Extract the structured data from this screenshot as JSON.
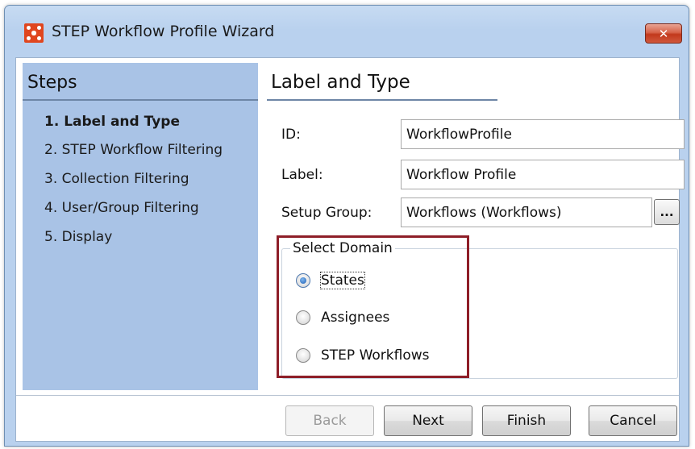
{
  "window": {
    "title": "STEP Workflow Profile Wizard",
    "close_glyph": "✕",
    "icon": "app-logo-icon"
  },
  "steps": {
    "title": "Steps",
    "items": [
      {
        "label": "1. Label and Type",
        "active": true
      },
      {
        "label": "2. STEP Workflow Filtering",
        "active": false
      },
      {
        "label": "3. Collection Filtering",
        "active": false
      },
      {
        "label": "4. User/Group Filtering",
        "active": false
      },
      {
        "label": "5. Display",
        "active": false
      }
    ]
  },
  "content": {
    "title": "Label and Type",
    "fields": {
      "id": {
        "label": "ID:",
        "value": "WorkflowProfile"
      },
      "label": {
        "label": "Label:",
        "value": "Workflow Profile"
      },
      "setup_group": {
        "label": "Setup Group:",
        "value": "Workflows (Workflows)",
        "browse_label": "..."
      }
    },
    "domain": {
      "legend": "Select Domain",
      "options": [
        {
          "label": "States",
          "selected": true
        },
        {
          "label": "Assignees",
          "selected": false
        },
        {
          "label": "STEP Workflows",
          "selected": false
        }
      ]
    }
  },
  "footer": {
    "back": "Back",
    "next": "Next",
    "finish": "Finish",
    "cancel": "Cancel"
  },
  "colors": {
    "steps_panel_bg": "#a9c3e6",
    "highlight_border": "#8e1e28",
    "close_button": "#c2391c",
    "app_icon": "#e0461f"
  }
}
